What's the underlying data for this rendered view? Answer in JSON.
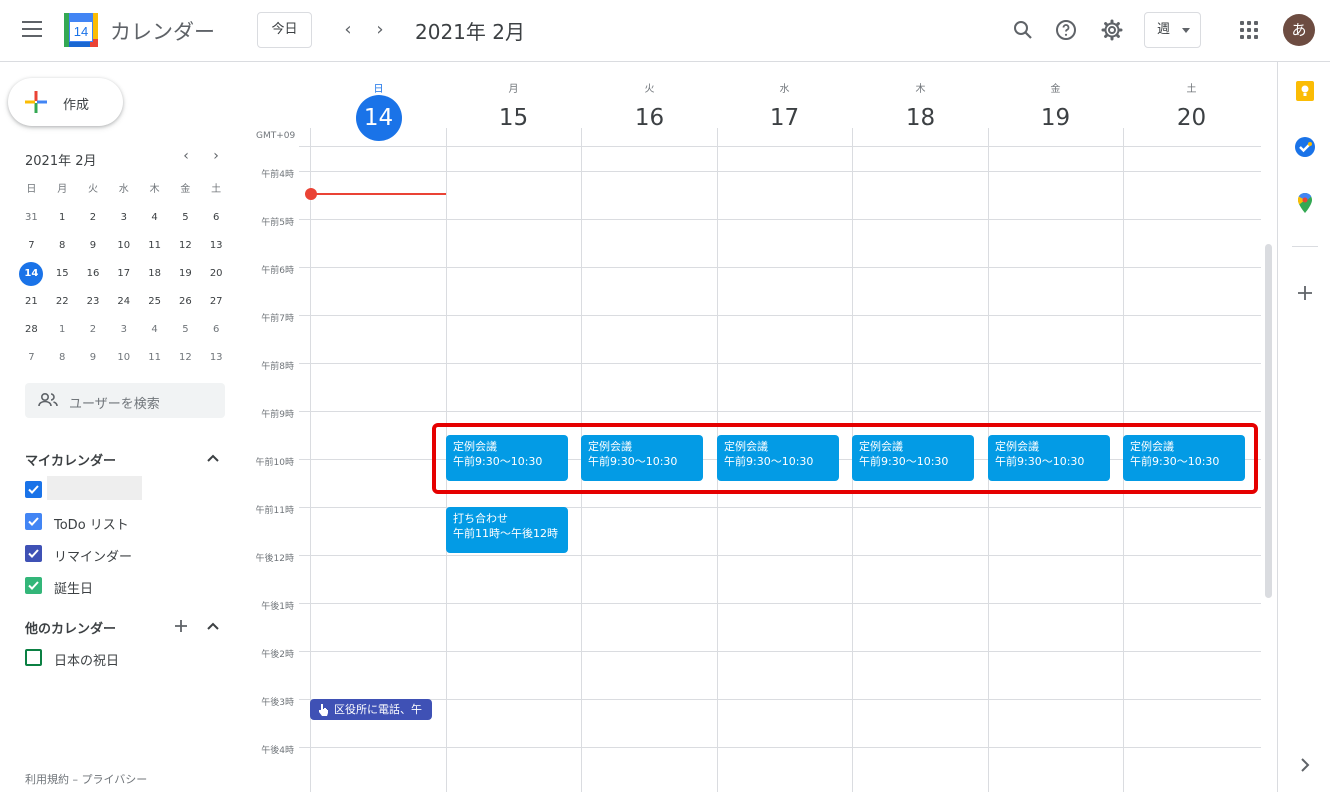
{
  "header": {
    "app_title": "カレンダー",
    "logo_day": "14",
    "today_button": "今日",
    "current_period": "2021年 2月",
    "view_select": "週",
    "avatar_initial": "あ",
    "prev_arrow": "‹",
    "next_arrow": "›"
  },
  "sidebar": {
    "create_label": "作成",
    "mini_calendar": {
      "title": "2021年 2月",
      "prev": "‹",
      "next": "›",
      "weekdays": [
        "日",
        "月",
        "火",
        "水",
        "木",
        "金",
        "土"
      ],
      "weeks": [
        [
          "31",
          "1",
          "2",
          "3",
          "4",
          "5",
          "6"
        ],
        [
          "7",
          "8",
          "9",
          "10",
          "11",
          "12",
          "13"
        ],
        [
          "14",
          "15",
          "16",
          "17",
          "18",
          "19",
          "20"
        ],
        [
          "21",
          "22",
          "23",
          "24",
          "25",
          "26",
          "27"
        ],
        [
          "28",
          "1",
          "2",
          "3",
          "4",
          "5",
          "6"
        ],
        [
          "7",
          "8",
          "9",
          "10",
          "11",
          "12",
          "13"
        ]
      ]
    },
    "search_users_placeholder": "ユーザーを検索",
    "my_calendars_title": "マイカレンダー",
    "my_calendars": [
      {
        "label": "",
        "color": "#1a73e8"
      },
      {
        "label": "ToDo リスト",
        "color": "#4285f4"
      },
      {
        "label": "リマインダー",
        "color": "#3f51b5"
      },
      {
        "label": "誕生日",
        "color": "#33b679"
      }
    ],
    "other_calendars_title": "他のカレンダー",
    "other_calendars": [
      {
        "label": "日本の祝日",
        "color": "#0b8043"
      }
    ],
    "footer": "利用規約 – プライバシー"
  },
  "week": {
    "timezone": "GMT+09",
    "days": [
      {
        "name": "日",
        "num": "14"
      },
      {
        "name": "月",
        "num": "15"
      },
      {
        "name": "火",
        "num": "16"
      },
      {
        "name": "水",
        "num": "17"
      },
      {
        "name": "木",
        "num": "18"
      },
      {
        "name": "金",
        "num": "19"
      },
      {
        "name": "土",
        "num": "20"
      }
    ],
    "time_labels": [
      "午前4時",
      "午前5時",
      "午前6時",
      "午前7時",
      "午前8時",
      "午前9時",
      "午前10時",
      "午前11時",
      "午後12時",
      "午後1時",
      "午後2時",
      "午後3時",
      "午後4時"
    ]
  },
  "events": {
    "recurring": [
      {
        "title": "定例会議",
        "time": "午前9:30〜10:30"
      },
      {
        "title": "定例会議",
        "time": "午前9:30〜10:30"
      },
      {
        "title": "定例会議",
        "time": "午前9:30〜10:30"
      },
      {
        "title": "定例会議",
        "time": "午前9:30〜10:30"
      },
      {
        "title": "定例会議",
        "time": "午前9:30〜10:30"
      },
      {
        "title": "定例会議",
        "time": "午前9:30〜10:30"
      }
    ],
    "meeting": {
      "title": "打ち合わせ",
      "time": "午前11時〜午後12時"
    },
    "task": {
      "title": "区役所に電話、午"
    }
  },
  "colors": {
    "accent": "#1a73e8",
    "event": "#039be5",
    "task": "#3f51b5",
    "now_line": "#ea4335",
    "highlight": "#e50000"
  }
}
